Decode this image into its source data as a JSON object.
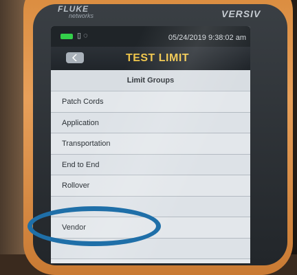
{
  "device": {
    "brand": "FLUKE",
    "brand_sub": "networks",
    "model": "VERSIV"
  },
  "status": {
    "datetime": "05/24/2019 9:38:02 am",
    "battery_color": "#33d04a",
    "icons": [
      "battery-icon",
      "card-icon",
      "signal-icon"
    ]
  },
  "header": {
    "title": "TEST LIMIT",
    "title_color": "#f0c64a",
    "back_icon": "back-arrow-icon"
  },
  "limit_groups": {
    "heading": "Limit Groups",
    "items": [
      "Patch Cords",
      "Application",
      "Transportation",
      "End to End",
      "Rollover",
      "",
      "Vendor",
      ""
    ]
  },
  "annotation": {
    "ellipse_color": "#1f6fa8"
  }
}
